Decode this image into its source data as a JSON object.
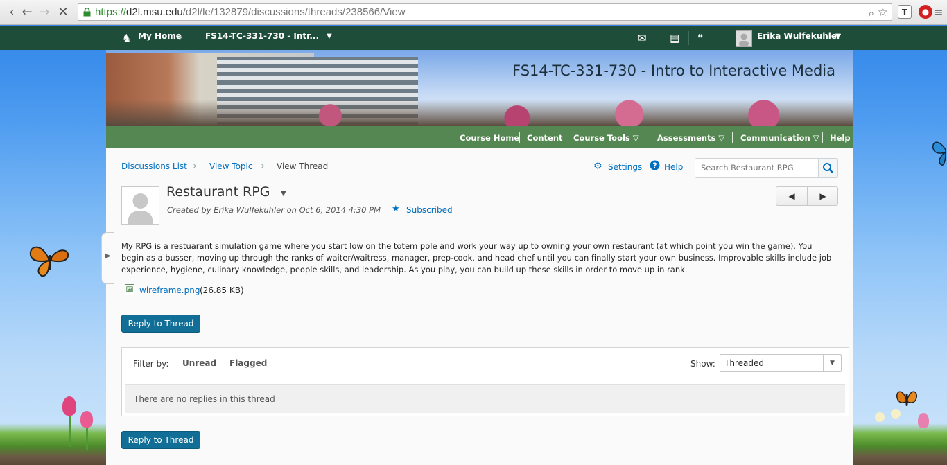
{
  "browser": {
    "url_scheme": "https://",
    "url_host": "d2l.msu.edu",
    "url_path": "/d2l/le/132879/discussions/threads/238566/View",
    "ext_1": "T"
  },
  "minibar": {
    "home_label": "My Home",
    "course_label": "FS14-TC-331-730 - Intr...",
    "user_name": "Erika Wulfekuhler"
  },
  "banner": {
    "course_title": "FS14-TC-331-730 - Intro to Interactive Media"
  },
  "course_nav": {
    "items": [
      "Course Home",
      "Content",
      "Course Tools",
      "Assessments",
      "Communication",
      "Help"
    ]
  },
  "breadcrumb": {
    "items": [
      "Discussions List",
      "View Topic",
      "View Thread"
    ]
  },
  "toolbar": {
    "settings_label": "Settings",
    "help_label": "Help",
    "search_placeholder": "Search Restaurant RPG"
  },
  "thread": {
    "title": "Restaurant RPG",
    "byline": "Created by Erika Wulfekuhler on Oct 6, 2014 4:30 PM",
    "subscribed_label": "Subscribed",
    "body": "My RPG is a restuarant simulation game where you start low on the totem pole and work your way up to owning your own restaurant (at which point you win the game). You begin as a busser, moving up through the ranks of waiter/waitress, manager, prep-cook, and head chef until you can finally start your own business. Improvable skills include job experience, hygiene, culinary knowledge, people skills, and leadership. As you play, you can build up these skills in order to move up in rank.",
    "attachment_name": "wireframe.png",
    "attachment_size": "(26.85 KB)",
    "reply_label": "Reply to Thread"
  },
  "filters": {
    "label": "Filter by:",
    "options": [
      "Unread",
      "Flagged"
    ],
    "show_label": "Show:",
    "show_value": "Threaded",
    "empty_message": "There are no replies in this thread"
  },
  "colors": {
    "minibar": "#1e4d3a",
    "course_nav": "#558752",
    "link": "#006fbf",
    "button": "#116f97"
  }
}
